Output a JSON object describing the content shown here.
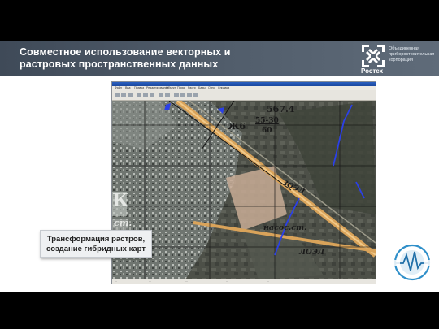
{
  "slide": {
    "title": "Совместное использование векторных и растровых пространственных данных",
    "caption": "Трансформация растров, создание гибридных карт"
  },
  "brand": {
    "name": "Ростех",
    "corp_line_1": "Объединенная",
    "corp_line_2": "приборостроительная",
    "corp_line_3": "корпорация",
    "accent_color": "#3f4a58"
  },
  "app": {
    "menu": [
      "Файл",
      "Вид",
      "Правка",
      "Редактирование",
      "Объект",
      "Поиск",
      "Растр",
      "Базы",
      "Окно",
      "Справка"
    ],
    "status": [
      "...",
      "...",
      "...",
      "...",
      "..."
    ]
  },
  "map": {
    "labels": {
      "sheet": "567.4",
      "district": "Ж6",
      "fraction_top": "55-30",
      "fraction_bottom": "60",
      "pump_station": "насос.ст.",
      "rail_1": "ЗОЭЛ",
      "rail_2": "ЛОЭЛ",
      "big_letters": "К",
      "partial_word": "ст."
    }
  },
  "icons": [
    "rostec-logo-icon",
    "niikp-logo-icon"
  ]
}
